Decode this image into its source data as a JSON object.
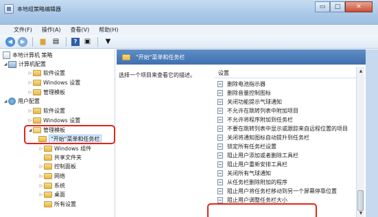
{
  "window": {
    "title": "本地组策略编辑器",
    "controls": {
      "minimize": "▭",
      "maximize": "□",
      "close": "✕"
    }
  },
  "menu": [
    "文件(F)",
    "操作(A)",
    "查看(V)",
    "帮助(H)"
  ],
  "toolbar": {
    "icons": [
      "back-arrow-icon",
      "forward-arrow-icon",
      "folder-icon",
      "properties-icon",
      "help-icon",
      "view-icon",
      "filter-icon"
    ],
    "glyphs": {
      "back": "◀",
      "forward": "▶",
      "folder": "▆",
      "properties": "▤",
      "help": "?",
      "view": "▣",
      "filter": "▼"
    }
  },
  "tree": {
    "root": "本地计算机 策略",
    "computer_config": "计算机配置",
    "c_software": "软件设置",
    "c_windows": "Windows 设置",
    "c_admin": "管理模板",
    "user_config": "用户配置",
    "u_software": "软件设置",
    "u_windows": "Windows 设置",
    "u_admin": "管理模板",
    "start_menu": "\"开始\"菜单和任务栏",
    "windows_components": "Windows 组件",
    "shared_folders": "共享文件夹",
    "control_panel": "控制面板",
    "network": "网络",
    "system": "系统",
    "desktop": "桌面",
    "all_settings": "所有设置"
  },
  "right": {
    "header": "\"开始\"菜单和任务栏",
    "description": "选择一个项目来查看它的描述。",
    "column": "设置",
    "settings": [
      "删除电池指示器",
      "删除音量控制图标",
      "关闭功能提示气球通知",
      "不允许在跳转列表中附加项目",
      "不允许将程序附加到任务栏",
      "不要在跳转列表中显示或跟踪来自远程位置的项目",
      "关闭将通知图标自动提升到任务栏",
      "锁定所有任务栏设置",
      "阻止用户添加或者删除工具栏",
      "阻止用户重新安排工具栏",
      "关闭所有气球通知",
      "从任务栏删除附加的程序",
      "阻止用户将任务栏移动到另一个屏幕停靠位置",
      "阻止用户调整任务栏大小"
    ]
  },
  "colors": {
    "highlight": "#e0241b",
    "header_bg": "#4f7fbc",
    "title_bg": "#a9c8e8"
  }
}
